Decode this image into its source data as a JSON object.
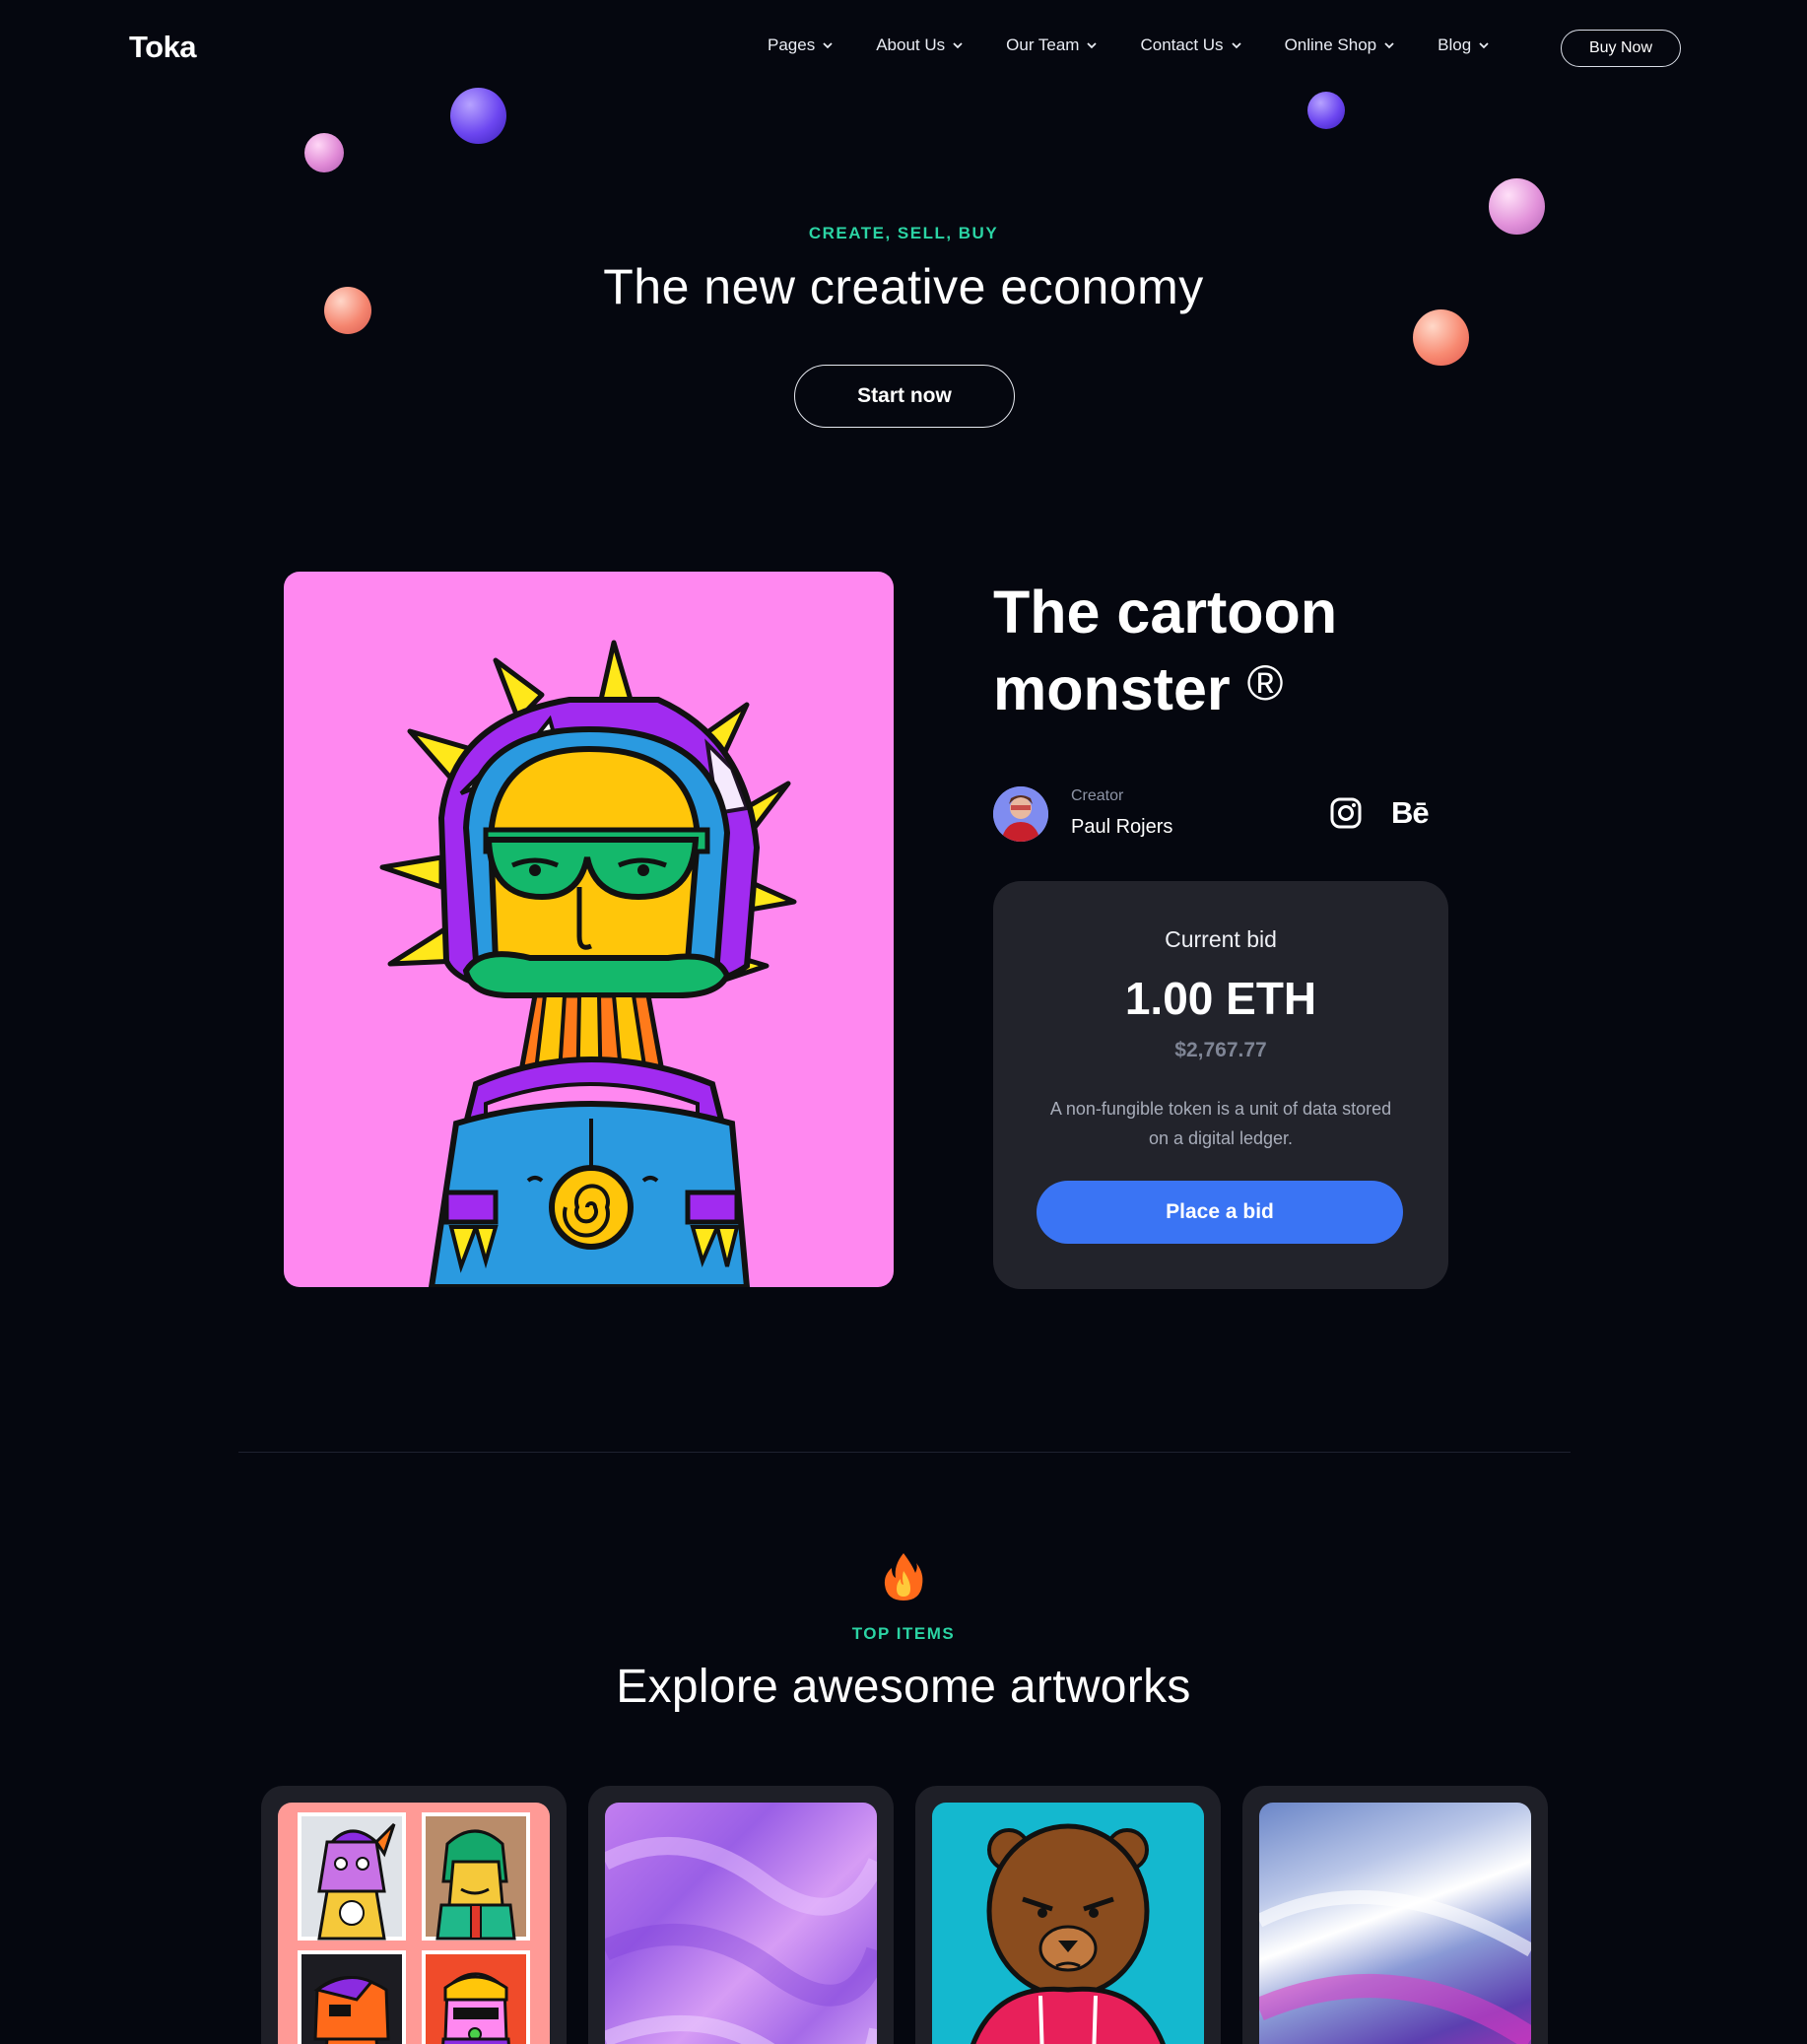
{
  "nav": {
    "logo": "Toka",
    "items": [
      {
        "label": "Pages"
      },
      {
        "label": "About Us"
      },
      {
        "label": "Our Team"
      },
      {
        "label": "Contact Us"
      },
      {
        "label": "Online Shop"
      },
      {
        "label": "Blog"
      }
    ],
    "buy_label": "Buy Now"
  },
  "hero": {
    "tagline": "CREATE, SELL, BUY",
    "title": "The new creative economy",
    "cta": "Start now"
  },
  "feature": {
    "title": "The cartoon monster",
    "mark": "®",
    "creator_label": "Creator",
    "creator_name": "Paul Rojers",
    "social": {
      "instagram_icon": "instagram-icon",
      "behance_text": "Bē"
    },
    "bid": {
      "label": "Current bid",
      "amount": "1.00 ETH",
      "usd": "$2,767.77",
      "description": "A non-fungible token is a unit of data stored on a digital ledger.",
      "button": "Place a bid"
    }
  },
  "top_items": {
    "tagline": "TOP ITEMS",
    "title": "Explore awesome artworks"
  },
  "colors": {
    "background": "#05070f",
    "accent_teal": "#2bd4a4",
    "bid_button": "#3a74f4",
    "card": "#22232b",
    "art_pink": "#ff88f0"
  }
}
